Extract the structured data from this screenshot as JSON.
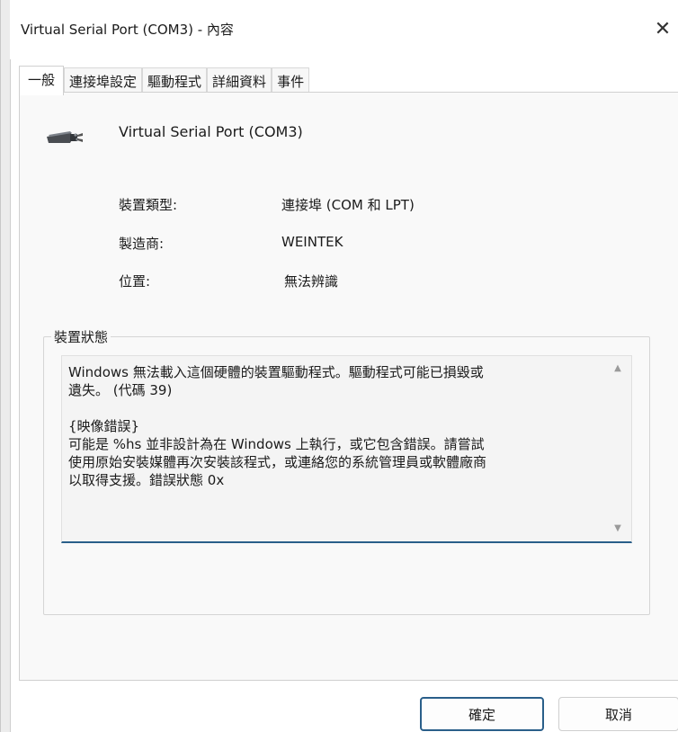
{
  "window": {
    "title": "Virtual Serial Port (COM3) - 內容",
    "close_glyph": "✕"
  },
  "tabs": [
    {
      "label": "一般",
      "active": true
    },
    {
      "label": "連接埠設定",
      "active": false
    },
    {
      "label": "驅動程式",
      "active": false
    },
    {
      "label": "詳細資料",
      "active": false
    },
    {
      "label": "事件",
      "active": false
    }
  ],
  "device": {
    "icon": "serial-port-icon",
    "name": "Virtual Serial Port (COM3)"
  },
  "properties": [
    {
      "label": "裝置類型:",
      "value": "連接埠 (COM 和 LPT)"
    },
    {
      "label": "製造商:",
      "value": "WEINTEK"
    },
    {
      "label": "位置:",
      "value": "無法辨識"
    }
  ],
  "status": {
    "legend": "裝置狀態",
    "text": "Windows 無法載入這個硬體的裝置驅動程式。驅動程式可能已損毀或\n遺失。 (代碼 39)\n\n{映像錯誤}\n可能是 %hs 並非設計為在 Windows 上執行，或它包含錯誤。請嘗試\n使用原始安裝媒體再次安裝該程式，或連絡您的系統管理員或軟體廠商\n以取得支援。錯誤狀態 0x",
    "scroll_up_glyph": "▲",
    "scroll_down_glyph": "▼"
  },
  "footer": {
    "ok_label": "確定",
    "cancel_label": "取消"
  },
  "colors": {
    "accent": "#2a5f8a",
    "panel_bg": "#f9f9f9",
    "window_bg": "#ffffff"
  }
}
